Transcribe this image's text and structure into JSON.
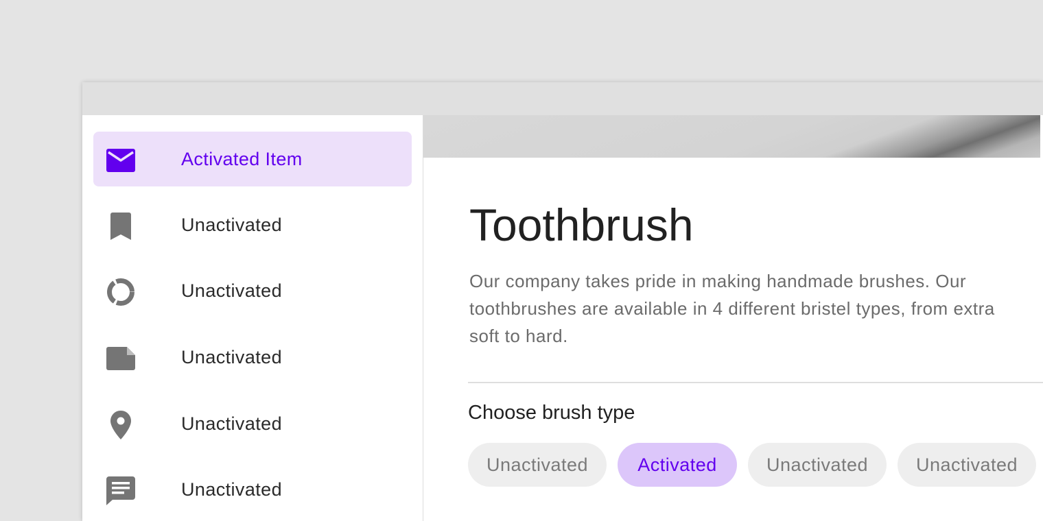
{
  "drawer": {
    "items": [
      {
        "label": "Activated Item",
        "icon": "mail-icon",
        "active": true
      },
      {
        "label": "Unactivated",
        "icon": "bookmark-icon",
        "active": false
      },
      {
        "label": "Unactivated",
        "icon": "donut-chart-icon",
        "active": false
      },
      {
        "label": "Unactivated",
        "icon": "note-icon",
        "active": false
      },
      {
        "label": "Unactivated",
        "icon": "location-pin-icon",
        "active": false
      },
      {
        "label": "Unactivated",
        "icon": "message-icon",
        "active": false
      }
    ]
  },
  "product": {
    "title": "Toothbrush",
    "description": "Our company takes pride in making handmade brushes. Our toothbrushes are available in 4 different bristel types, from extra soft to hard."
  },
  "brush_type": {
    "heading": "Choose brush type",
    "chips": [
      {
        "label": "Unactivated",
        "active": false
      },
      {
        "label": "Activated",
        "active": true
      },
      {
        "label": "Unactivated",
        "active": false
      },
      {
        "label": "Unactivated",
        "active": false
      }
    ]
  },
  "colors": {
    "accent": "#6200ee",
    "active_item_bg": "#ede0fa",
    "active_chip_bg": "#dcc6fa",
    "icon_gray": "#757575",
    "background": "#e4e4e4"
  }
}
